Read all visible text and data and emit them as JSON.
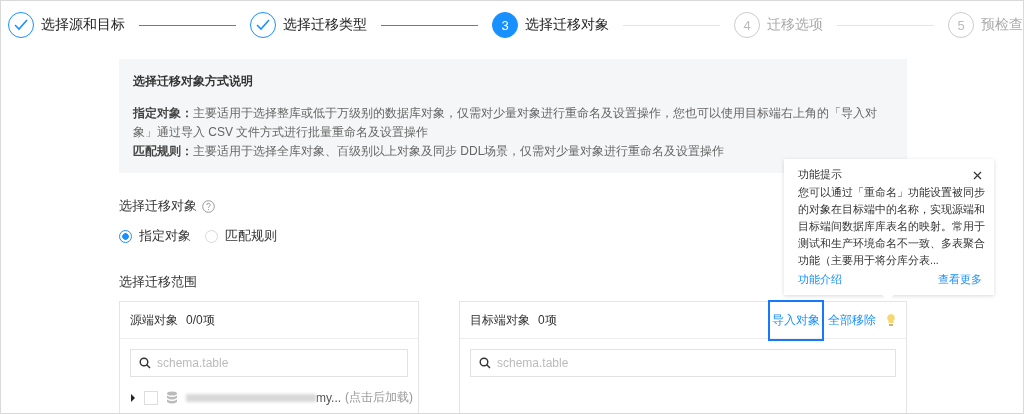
{
  "steps": [
    {
      "label": "选择源和目标",
      "kind": "done"
    },
    {
      "label": "选择迁移类型",
      "kind": "done"
    },
    {
      "number": "3",
      "label": "选择迁移对象",
      "kind": "current"
    },
    {
      "number": "4",
      "label": "迁移选项",
      "kind": "pending"
    },
    {
      "number": "5",
      "label": "预检查",
      "kind": "pending"
    }
  ],
  "info": {
    "title": "选择迁移对象方式说明",
    "paragraphs": [
      "**指定对象：**主要适用于选择整库或低于万级别的数据库对象，仅需对少量对象进行重命名及设置操作，您也可以使用目标端右上角的「导入对象」通过导入 CSV 文件方式进行批量重命名及设置操作",
      "**匹配规则：**主要适用于选择全库对象、百级别以上对象及同步 DDL场景，仅需对少量对象进行重命名及设置操作"
    ]
  },
  "object_mode": {
    "label": "选择迁移对象",
    "options": [
      {
        "label": "指定对象",
        "selected": true
      },
      {
        "label": "匹配规则",
        "selected": false
      }
    ]
  },
  "scope": {
    "label": "选择迁移范围",
    "source": {
      "title": "源端对象",
      "count": "0/0项",
      "placeholder": "schema.table",
      "tree": [
        {
          "name": "my...",
          "hint": "(点击后加载)",
          "checked": false,
          "expanded": false
        }
      ]
    },
    "target": {
      "title": "目标端对象",
      "count": "0项",
      "placeholder": "schema.table",
      "actions": [
        {
          "label": "导入对象",
          "highlighted": true
        },
        {
          "label": "全部移除",
          "highlighted": false
        }
      ]
    }
  },
  "popover": {
    "title": "功能提示",
    "body_lines": [
      "您可以通过「重命名」功能设置被同步",
      "的对象在目标端中的名称，实现源端和",
      "目标端间数据库库表名的映射。常用于",
      "测试和生产环境命名不一致、多表聚合",
      "功能（主要用于将分库分表..."
    ],
    "links": [
      "功能介绍",
      "查看更多"
    ]
  }
}
